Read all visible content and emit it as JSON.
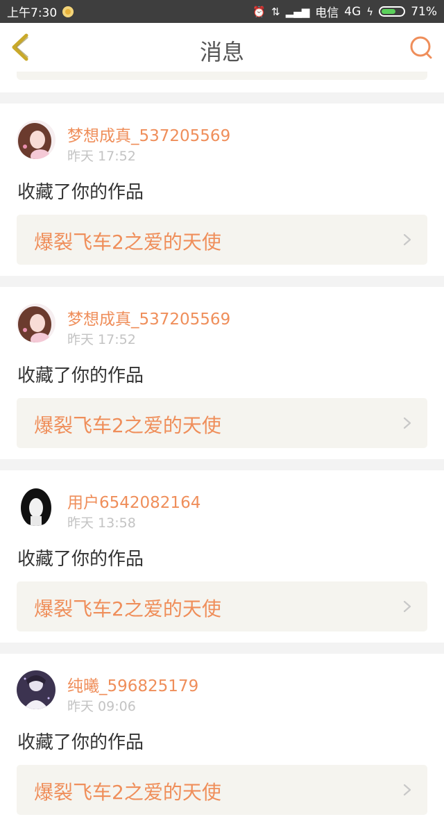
{
  "status_bar": {
    "time": "上午7:30",
    "carrier": "电信",
    "network": "4G",
    "battery_percent": "71%",
    "battery_level": 0.71
  },
  "nav": {
    "title": "消息",
    "back_icon": "back-chevron-icon",
    "search_icon": "search-icon"
  },
  "messages": [
    {
      "username": "梦想成真_537205569",
      "time": "昨天 17:52",
      "action": "收藏了你的作品",
      "work_title": "爆裂飞车2之爱的天使",
      "avatar": "avatar-girl-brown-hair"
    },
    {
      "username": "梦想成真_537205569",
      "time": "昨天 17:52",
      "action": "收藏了你的作品",
      "work_title": "爆裂飞车2之爱的天使",
      "avatar": "avatar-girl-brown-hair"
    },
    {
      "username": "用户6542082164",
      "time": "昨天 13:58",
      "action": "收藏了你的作品",
      "work_title": "爆裂飞车2之爱的天使",
      "avatar": "avatar-girl-black-hair"
    },
    {
      "username": "纯曦_596825179",
      "time": "昨天 09:06",
      "action": "收藏了你的作品",
      "work_title": "爆裂飞车2之爱的天使",
      "avatar": "avatar-boy-purple"
    }
  ],
  "colors": {
    "accent": "#ef8e5a",
    "back_icon": "#c9a92a",
    "work_bg": "#f5f4ef"
  }
}
